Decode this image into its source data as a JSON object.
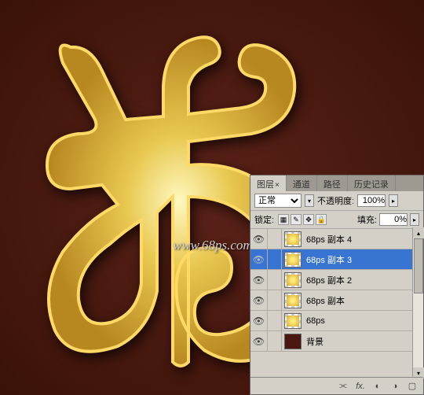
{
  "watermark": "www.68ps.com",
  "panel": {
    "tabs": {
      "layers": "图层",
      "channels": "通道",
      "paths": "路径",
      "history": "历史记录"
    },
    "blend_mode": "正常",
    "opacity_label": "不透明度:",
    "opacity_value": "100%",
    "lock_label": "锁定:",
    "fill_label": "填充:",
    "fill_value": "0%"
  },
  "layers": [
    {
      "name": "68ps 副本 4",
      "visible": true,
      "selected": false,
      "type": "gold"
    },
    {
      "name": "68ps 副本 3",
      "visible": true,
      "selected": true,
      "type": "gold"
    },
    {
      "name": "68ps 副本 2",
      "visible": true,
      "selected": false,
      "type": "gold"
    },
    {
      "name": "68ps 副本",
      "visible": true,
      "selected": false,
      "type": "gold"
    },
    {
      "name": "68ps",
      "visible": true,
      "selected": false,
      "type": "gold"
    },
    {
      "name": "背景",
      "visible": true,
      "selected": false,
      "type": "bg"
    }
  ],
  "footer_icons": [
    "link",
    "fx",
    "mask",
    "adjust",
    "folder",
    "new",
    "trash"
  ]
}
